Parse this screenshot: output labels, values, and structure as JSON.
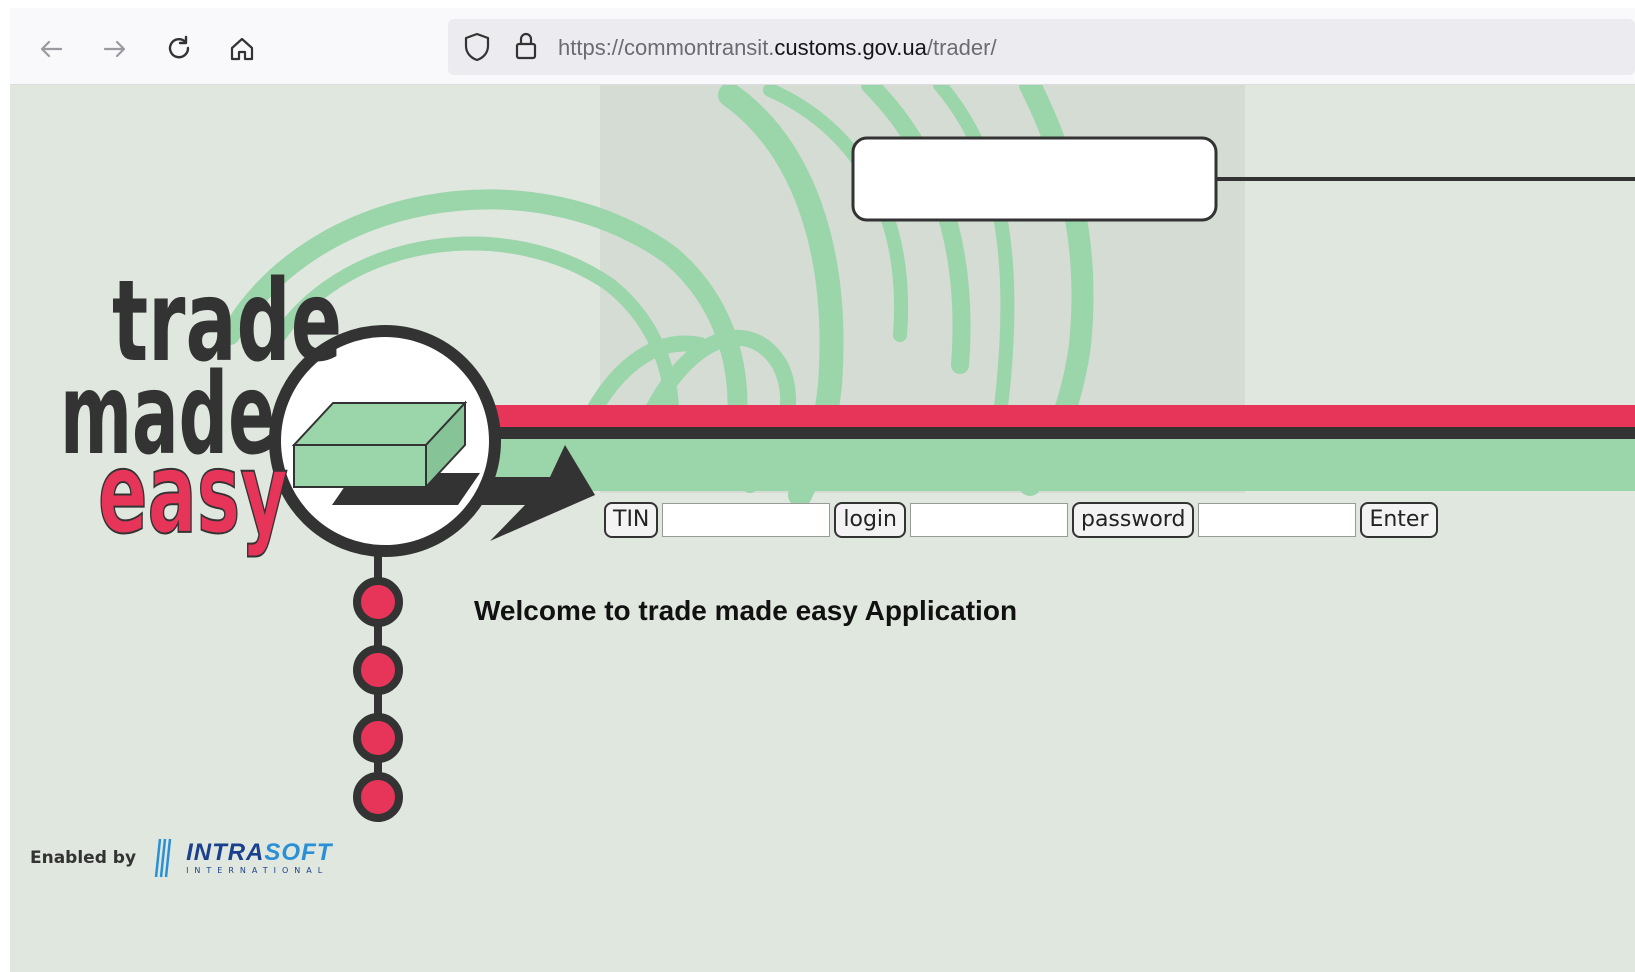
{
  "browser": {
    "url_prefix": "https://commontransit.",
    "url_domain": "customs.gov.ua",
    "url_path": "/trader/"
  },
  "logo": {
    "line1": "trade",
    "line2": "made",
    "line3": "easy"
  },
  "login": {
    "tin_label": "TIN",
    "login_label": "login",
    "password_label": "password",
    "enter_label": "Enter"
  },
  "welcome": "Welcome to trade made easy Application",
  "footer": {
    "enabled_by": "Enabled by",
    "brand_a": "INTRA",
    "brand_b": "SOFT",
    "brand_sub": "INTERNATIONAL"
  },
  "colors": {
    "page_bg": "#dfe7de",
    "accent_red": "#e63559",
    "accent_green": "#9bd5aa",
    "dark": "#333333"
  }
}
